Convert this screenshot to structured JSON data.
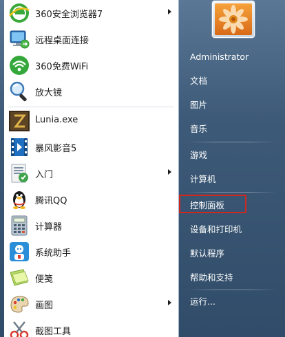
{
  "programs": [
    {
      "label": "360安全浏览器7",
      "icon": "browser-360-icon",
      "has_submenu": true
    },
    {
      "label": "远程桌面连接",
      "icon": "remote-desktop-icon",
      "has_submenu": false
    },
    {
      "label": "360免费WiFi",
      "icon": "wifi-360-icon",
      "has_submenu": false
    },
    {
      "label": "放大镜",
      "icon": "magnifier-icon",
      "has_submenu": false
    },
    {
      "label": "Lunia.exe",
      "icon": "lunia-game-icon",
      "has_submenu": false
    },
    {
      "label": "暴风影音5",
      "icon": "baofeng-player-icon",
      "has_submenu": false
    },
    {
      "label": "入门",
      "icon": "getting-started-icon",
      "has_submenu": true
    },
    {
      "label": "腾讯QQ",
      "icon": "qq-penguin-icon",
      "has_submenu": false
    },
    {
      "label": "计算器",
      "icon": "calculator-icon",
      "has_submenu": false
    },
    {
      "label": "系统助手",
      "icon": "system-assistant-icon",
      "has_submenu": false
    },
    {
      "label": "便笺",
      "icon": "sticky-notes-icon",
      "has_submenu": false
    },
    {
      "label": "画图",
      "icon": "paint-icon",
      "has_submenu": true
    },
    {
      "label": "截图工具",
      "icon": "snipping-tool-icon",
      "has_submenu": false
    }
  ],
  "right_pane": {
    "user_name": "Administrator",
    "items": [
      {
        "label": "文档"
      },
      {
        "label": "图片"
      },
      {
        "label": "音乐"
      },
      {
        "label": "游戏"
      },
      {
        "label": "计算机"
      },
      {
        "label": "控制面板",
        "highlighted": true
      },
      {
        "label": "设备和打印机"
      },
      {
        "label": "默认程序"
      },
      {
        "label": "帮助和支持"
      },
      {
        "label": "运行..."
      }
    ]
  },
  "colors": {
    "highlight_border": "#d0281d",
    "menu_background": "#3d5a78"
  }
}
